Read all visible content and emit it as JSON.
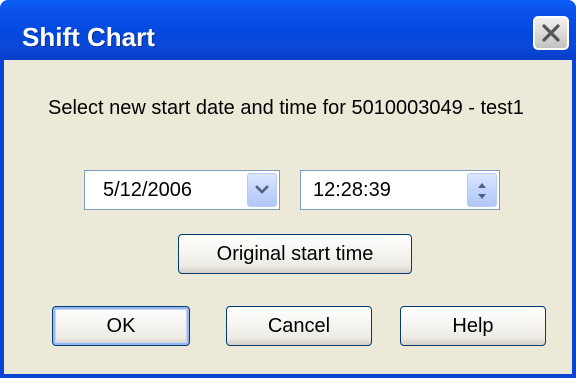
{
  "window": {
    "title": "Shift Chart"
  },
  "prompt": {
    "text": "Select new start date and time for 5010003049 - test1"
  },
  "date_picker": {
    "value": "5/12/2006"
  },
  "time_picker": {
    "value": "12:28:39"
  },
  "buttons": {
    "original_start_time": "Original start time",
    "ok": "OK",
    "cancel": "Cancel",
    "help": "Help"
  },
  "icons": {
    "close": "close-icon",
    "dropdown": "chevron-down-icon",
    "spin": "spin-updown-icon"
  },
  "colors": {
    "titlebar": "#0449e0",
    "client_bg": "#ece9d8",
    "button_border": "#003c74"
  }
}
